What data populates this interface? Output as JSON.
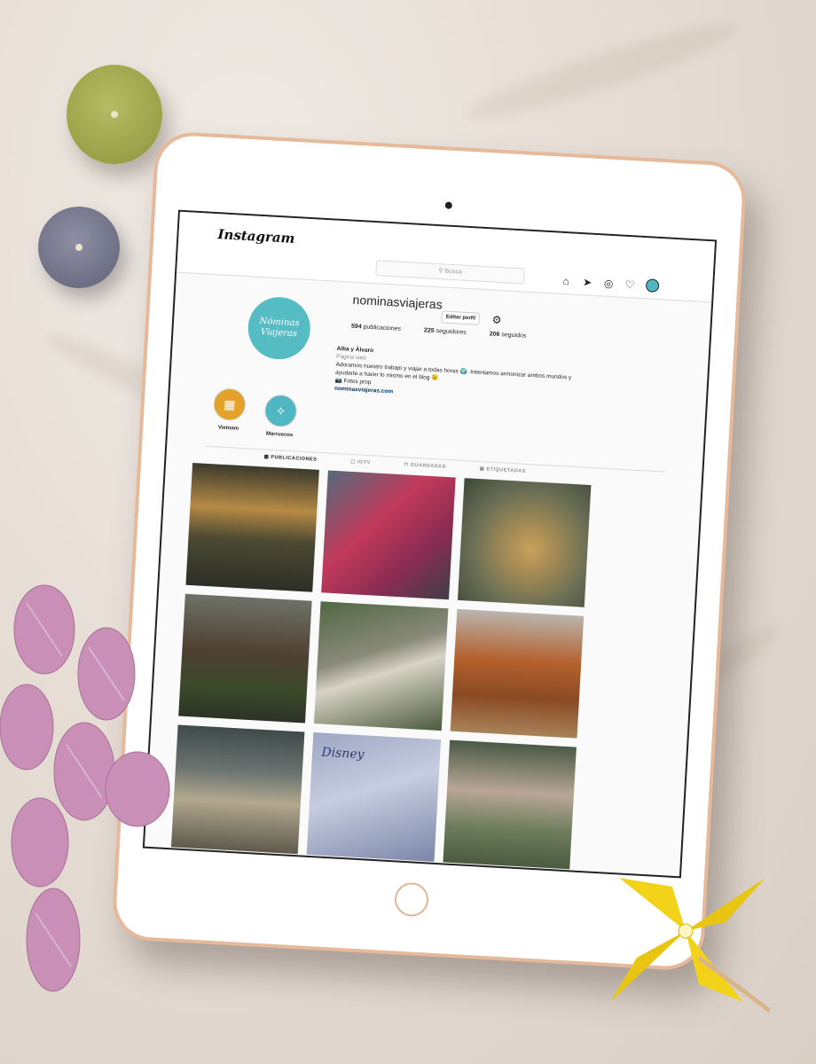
{
  "app": {
    "logo_text": "Instagram"
  },
  "search": {
    "placeholder": "Busca"
  },
  "nav": {
    "icons": [
      "home-icon",
      "send-icon",
      "compass-icon",
      "heart-icon",
      "avatar-icon"
    ]
  },
  "profile": {
    "avatar_text_line1": "Nóminas",
    "avatar_text_line2": "Viajeras",
    "username": "nominasviajeras",
    "edit_label": "Editar perfil",
    "stats": {
      "posts_count": "594",
      "posts_label": "publicaciones",
      "followers_count": "225",
      "followers_label": "seguidores",
      "following_count": "206",
      "following_label": "seguidos"
    },
    "bio": {
      "name": "Alba y Álvaro",
      "category": "Página web",
      "text": "Adoramos nuestro trabajo y viajar a todas horas 🌍. Intentamos armonizar ambos mundos y ayudarte a hacer lo mismo en el blog 😉",
      "photos": "📷 Fotos prop",
      "link": "nominasviajeras.com"
    }
  },
  "highlights": [
    {
      "label": "Vietnam",
      "color": "#e3a32a"
    },
    {
      "label": "Marruecos",
      "color": "#4fb7c1"
    }
  ],
  "tabs": [
    "PUBLICACIONES",
    "IGTV",
    "GUARDADAS",
    "ETIQUETADAS"
  ],
  "photos": {
    "disney_text": "Disney"
  },
  "colors": {
    "tablet_frame": "#e6b99a",
    "accent_teal": "#55bcc4",
    "pinwheel": "#f3d21a",
    "flowers": "#c98fb7"
  }
}
